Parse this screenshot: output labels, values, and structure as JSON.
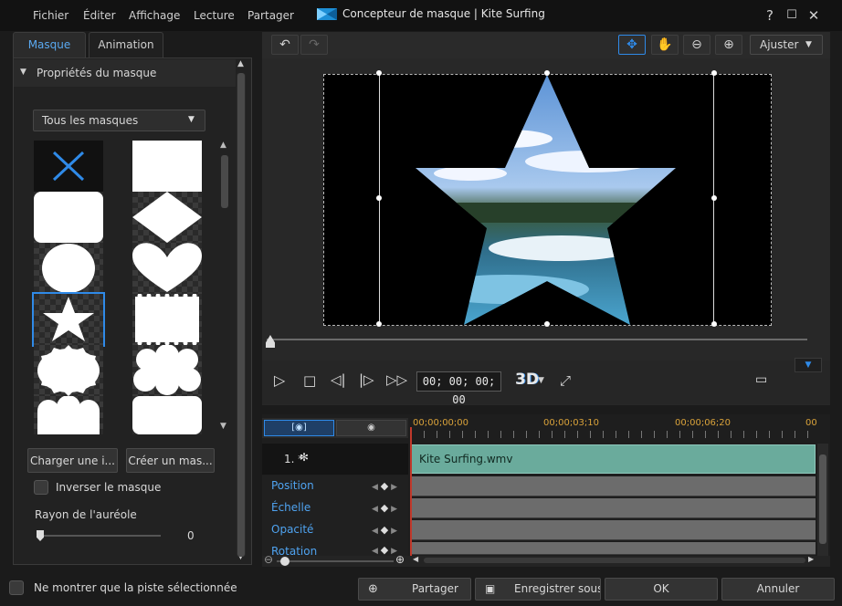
{
  "window": {
    "title": "Concepteur de masque",
    "project": "Kite Surfing",
    "separator": "|"
  },
  "menu": [
    "Fichier",
    "Éditer",
    "Affichage",
    "Lecture",
    "Partager"
  ],
  "window_controls": {
    "help": "?",
    "maximize": "☐",
    "close": "✕"
  },
  "tabs": {
    "mask": "Masque",
    "animation": "Animation"
  },
  "mask_panel": {
    "section_title": "Propriétés du masque",
    "filter_selected": "Tous les masques",
    "load_button": "Charger une i...",
    "create_button": "Créer un mas...",
    "invert_label": "Inverser le masque",
    "invert_checked": false,
    "feather_label": "Rayon de l'auréole",
    "feather_value": "0",
    "masks": [
      "none",
      "rectangle",
      "rounded-rectangle",
      "diamond",
      "circle",
      "heart",
      "star",
      "stamp",
      "burst",
      "cloud",
      "cloud-2",
      "rounded-rectangle-2"
    ],
    "selected_mask": "star"
  },
  "toolbar": {
    "fit_label": "Ajuster"
  },
  "player": {
    "timecode": "00; 00; 00; 00",
    "mode_3d": "3D",
    "playhead_position": 0
  },
  "timeline": {
    "ruler": [
      "00;00;00;00",
      "00;00;03;10",
      "00;00;06;20",
      "00"
    ],
    "track_index": "1. *",
    "clip_name": "Kite Surfing.wmv",
    "properties": [
      "Position",
      "Échelle",
      "Opacité",
      "Rotation"
    ]
  },
  "footer": {
    "show_selected_label": "Ne montrer que la piste sélectionnée",
    "share_button": "Partager",
    "save_as_button": "Enregistrer sous",
    "ok_button": "OK",
    "cancel_button": "Annuler"
  },
  "colors": {
    "accent": "#2f8ae8",
    "clip": "#6aab9c",
    "playhead": "#c0392b"
  }
}
